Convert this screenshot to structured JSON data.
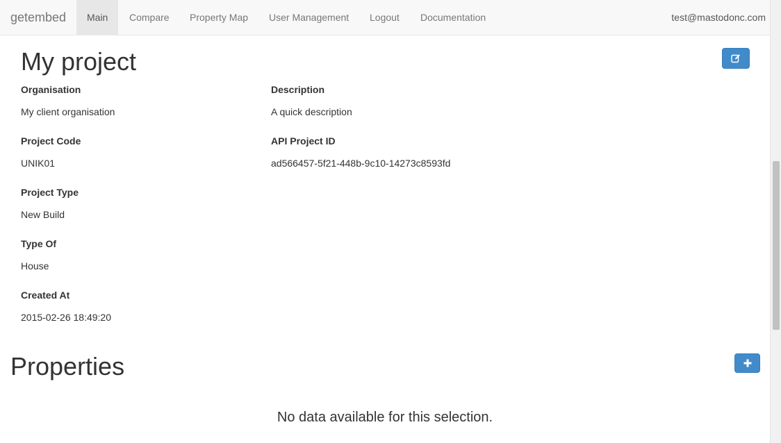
{
  "navbar": {
    "brand": "getembed",
    "items": [
      {
        "label": "Main",
        "active": true
      },
      {
        "label": "Compare"
      },
      {
        "label": "Property Map"
      },
      {
        "label": "User Management"
      },
      {
        "label": "Logout"
      },
      {
        "label": "Documentation"
      }
    ],
    "user_email": "test@mastodonc.com"
  },
  "project": {
    "title": "My project",
    "edit_icon": "edit-icon",
    "fields": {
      "organisation": {
        "label": "Organisation",
        "value": "My client organisation"
      },
      "description": {
        "label": "Description",
        "value": "A quick description"
      },
      "project_code": {
        "label": "Project Code",
        "value": "UNIK01"
      },
      "api_project_id": {
        "label": "API Project ID",
        "value": "ad566457-5f21-448b-9c10-14273c8593fd"
      },
      "project_type": {
        "label": "Project Type",
        "value": "New Build"
      },
      "type_of": {
        "label": "Type Of",
        "value": "House"
      },
      "created_at": {
        "label": "Created At",
        "value": "2015-02-26 18:49:20"
      }
    }
  },
  "properties": {
    "title": "Properties",
    "add_icon": "plus-icon",
    "empty_message": "No data available for this selection."
  },
  "colors": {
    "primary_button": "#428bca",
    "navbar_bg": "#f8f8f8",
    "nav_active_bg": "#e7e7e7"
  }
}
